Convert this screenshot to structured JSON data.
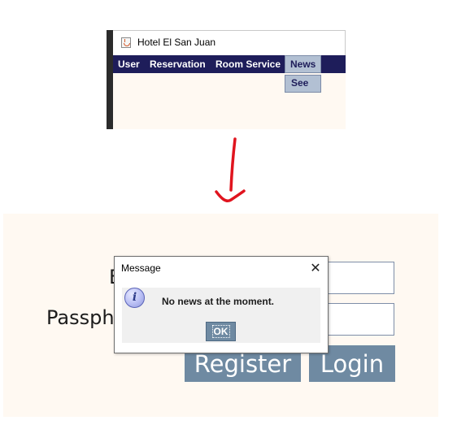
{
  "top_window": {
    "title": "Hotel El San Juan",
    "menubar": {
      "items": [
        {
          "label": "User"
        },
        {
          "label": "Reservation"
        },
        {
          "label": "Room Service"
        },
        {
          "label": "News",
          "active": true
        }
      ]
    },
    "dropdown": {
      "items": [
        {
          "label": "See"
        }
      ]
    }
  },
  "bottom_window": {
    "labels": {
      "email_partial": "E",
      "passphrase_partial": "Passph"
    },
    "buttons": {
      "register": "Register",
      "login": "Login"
    }
  },
  "dialog": {
    "title": "Message",
    "close_symbol": "✕",
    "icon_glyph": "i",
    "message": "No news at the moment.",
    "ok_label": "OK"
  },
  "colors": {
    "menubar_bg": "#1e1d5a",
    "menu_active_bg": "#b2c0d3",
    "content_bg": "#fff9f2",
    "button_bg": "#6f8aa2",
    "arrow": "#e0141e"
  }
}
